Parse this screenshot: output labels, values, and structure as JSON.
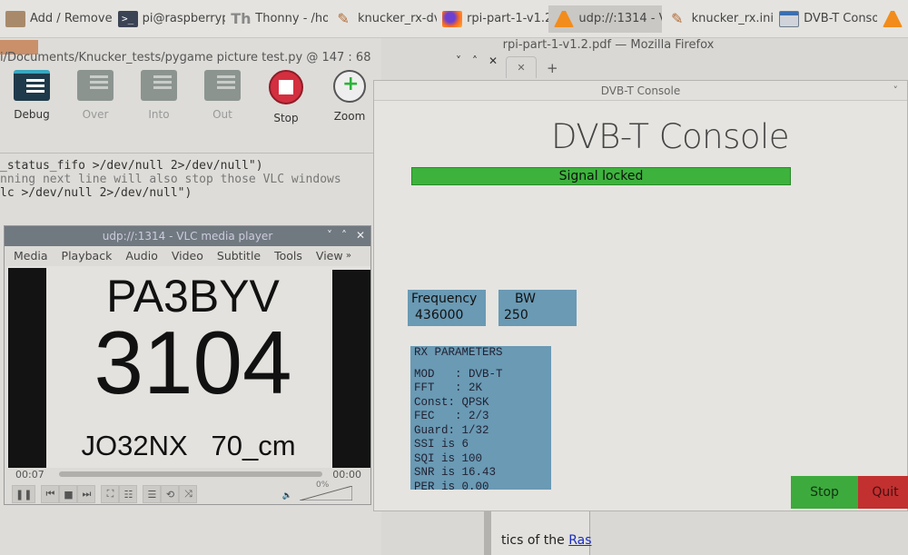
{
  "taskbar": {
    "tasks": [
      {
        "label": "Add / Remove ...",
        "icon": "package-icon"
      },
      {
        "label": "pi@raspberryp...",
        "icon": "terminal-icon"
      },
      {
        "label": "Thonny  -  /ho...",
        "icon": "thonny-icon"
      },
      {
        "label": "knucker_rx-dv...",
        "icon": "text-editor-icon"
      },
      {
        "label": "rpi-part-1-v1.2...",
        "icon": "firefox-icon"
      },
      {
        "label": "udp://:1314 - V...",
        "icon": "vlc-icon",
        "active": true
      },
      {
        "label": "knucker_rx.ini ...",
        "icon": "text-editor-icon"
      },
      {
        "label": "DVB-T Console",
        "icon": "window-icon"
      }
    ],
    "terminal_glyph": ">_",
    "thonny_glyph": "Th",
    "pencil_glyph": "✎"
  },
  "thonny": {
    "path": "i/Documents/Knucker_tests/pygame picture test.py  @  147 : 68",
    "toolbar": [
      {
        "label": "Debug",
        "enabled": true
      },
      {
        "label": "Over",
        "enabled": false
      },
      {
        "label": "Into",
        "enabled": false
      },
      {
        "label": "Out",
        "enabled": false
      },
      {
        "label": "Stop",
        "enabled": true
      },
      {
        "label": "Zoom",
        "enabled": true
      }
    ],
    "code_lines": [
      "_status_fifo >/dev/null 2>/dev/null\")",
      "nning next line will also stop those VLC windows",
      "lc >/dev/null 2>/dev/null\")"
    ]
  },
  "firefox": {
    "title": "rpi-part-1-v1.2.pdf — Mozilla Firefox",
    "window_buttons": [
      "˅",
      "˄",
      "✕"
    ],
    "tab_close": "✕",
    "new_tab": "+",
    "body_text": "tics of the ",
    "body_link": "Ras"
  },
  "vlc": {
    "title": "udp://:1314 - VLC media player",
    "window_buttons": [
      "˅",
      "˄",
      "✕"
    ],
    "menu": [
      "Media",
      "Playback",
      "Audio",
      "Video",
      "Subtitle",
      "Tools",
      "View"
    ],
    "menu_more": "»",
    "video": {
      "callsign": "PA3BYV",
      "number": "3104",
      "locator_line": "JO32NX   70_cm"
    },
    "elapsed": "00:07",
    "remaining": "00:00",
    "volume_label": "0%",
    "volume": 0,
    "controls": {
      "pause": "❚❚",
      "prev": "⏮",
      "stop": "■",
      "next": "⏭",
      "fullscreen": "⛶",
      "extended": "☷",
      "playlist": "☰",
      "loop": "⟲",
      "shuffle": "⤨",
      "speaker": "🔈"
    }
  },
  "dvb": {
    "window_title": "DVB-T Console",
    "heading": "DVB-T Console",
    "signal_status": "Signal locked",
    "signal_color": "#3db33d",
    "frequency": {
      "label": "Frequency",
      "value": "436000"
    },
    "bandwidth": {
      "label": "BW",
      "value": "250"
    },
    "rx": {
      "header": "RX PARAMETERS",
      "lines": [
        "MOD   : DVB-T",
        "FFT   : 2K",
        "Const: QPSK",
        "FEC   : 2/3",
        "Guard: 1/32",
        "SSI is 6",
        "SQI is 100",
        "SNR is 16.43",
        "PER is 0.00"
      ]
    },
    "stop_label": "Stop",
    "quit_label": "Quit",
    "chevron": "˅"
  }
}
